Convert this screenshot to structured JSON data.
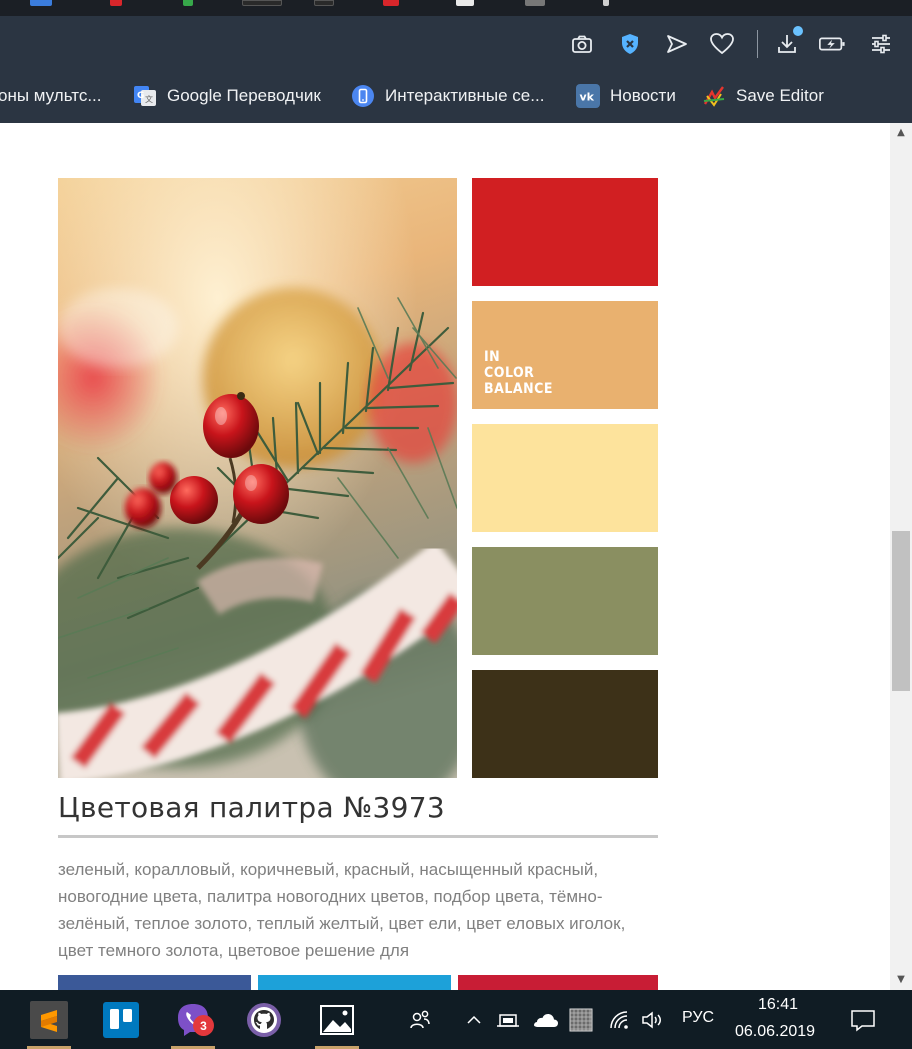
{
  "bookmarks": [
    {
      "label": "оны мультс...",
      "icon": "page-icon"
    },
    {
      "label": "Google Переводчик",
      "icon": "google-translate-icon"
    },
    {
      "label": "Интерактивные се...",
      "icon": "phone-icon"
    },
    {
      "label": "Новости",
      "icon": "vk-icon"
    },
    {
      "label": "Save Editor",
      "icon": "save-editor-icon"
    }
  ],
  "palette": {
    "title": "Цветовая палитра №3973",
    "brand_lines": [
      "IN",
      "COLOR",
      "BALANCE"
    ],
    "swatches": [
      "#d11f22",
      "#e9b16f",
      "#fde39c",
      "#8a8f61",
      "#3d3118"
    ],
    "tags": "зеленый, коралловый, коричневый, красный, насыщенный красный, новогодние цвета, палитра новогодних цветов, подбор цвета, тёмно-зелёный, теплое золото, теплый желтый, цвет ели, цвет еловых иголок, цвет темного золота, цветовое решение для",
    "share_colors": [
      "#3b5998",
      "#1da1d9",
      "#c81d35"
    ]
  },
  "taskbar": {
    "apps": [
      "sublime-text-icon",
      "trello-icon",
      "viber-icon",
      "github-icon",
      "photos-icon"
    ],
    "viber_badge": "3",
    "language": "РУС",
    "time": "16:41",
    "date": "06.06.2019"
  }
}
